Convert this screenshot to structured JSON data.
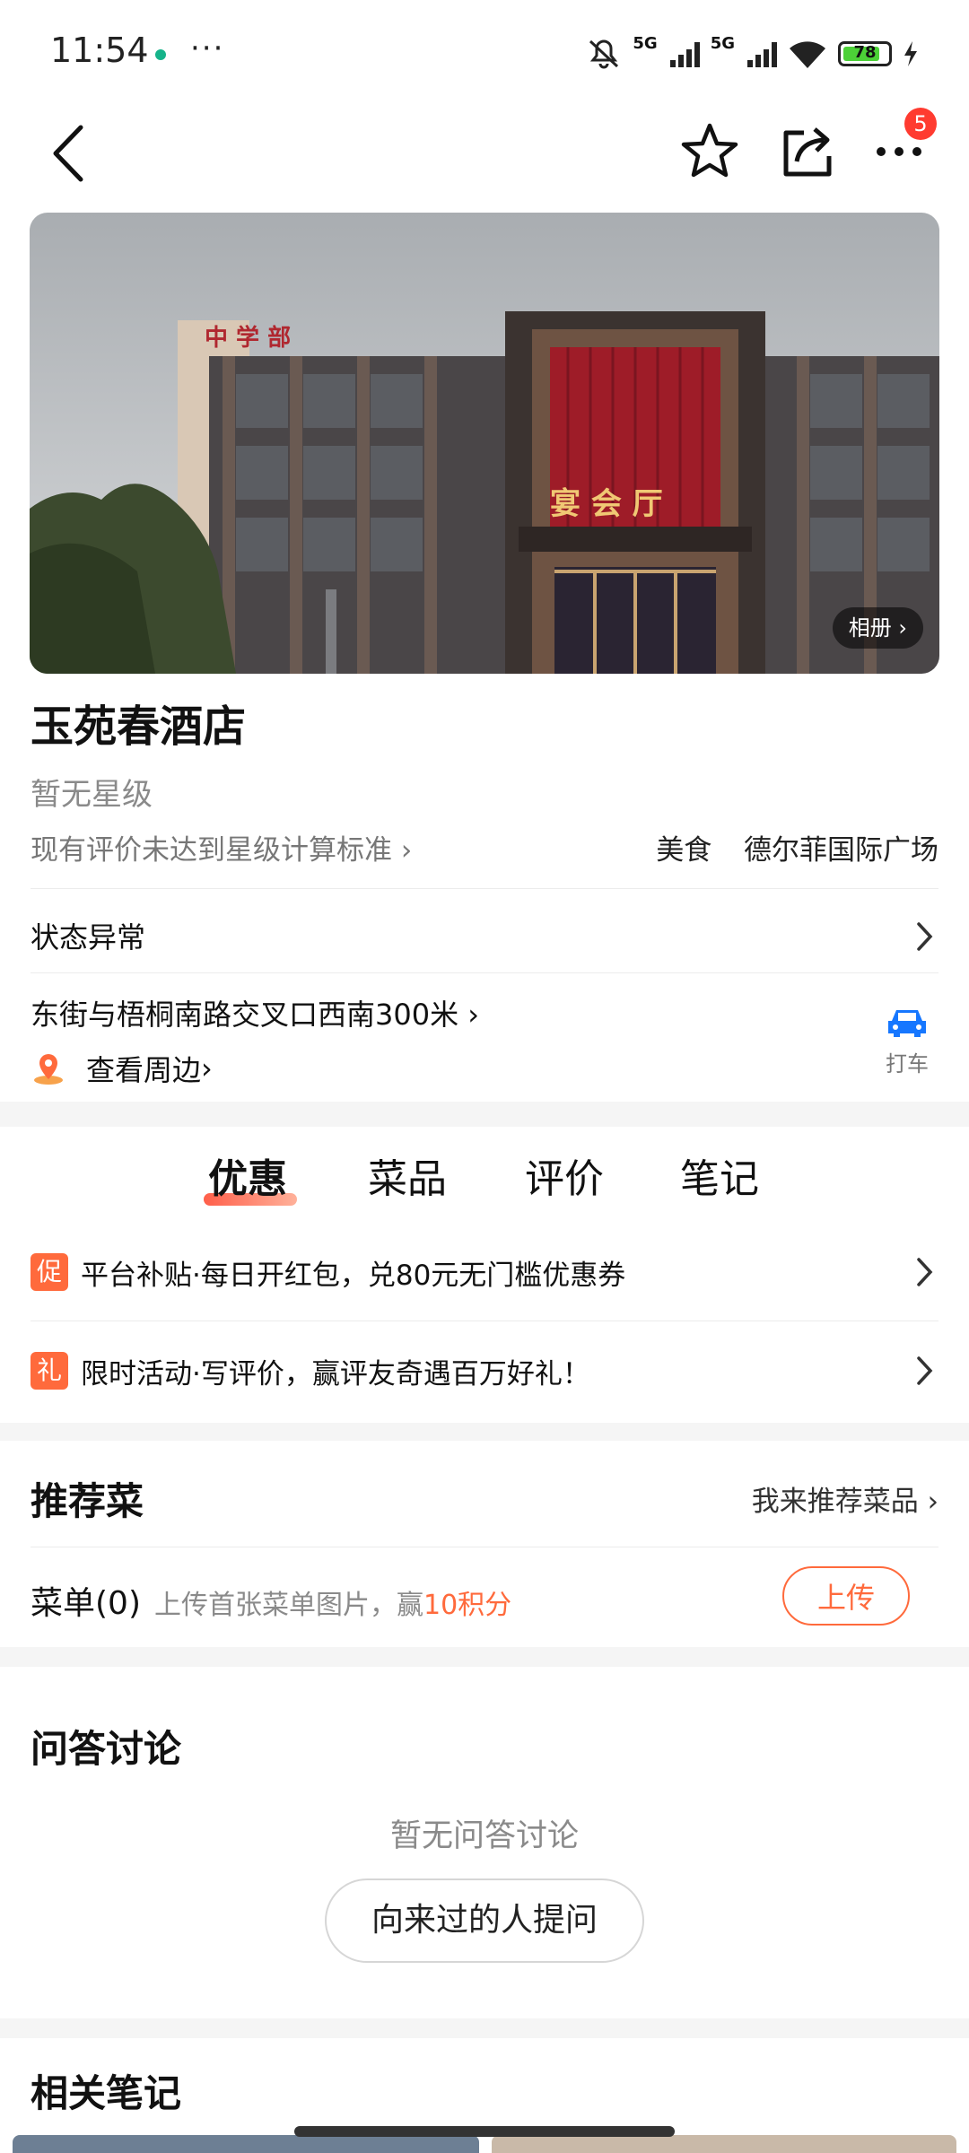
{
  "status_bar": {
    "time": "11:54",
    "dots": "···",
    "net1": "5G",
    "net2": "5G",
    "battery": "78"
  },
  "nav": {
    "badge_count": "5"
  },
  "hero": {
    "album_label": "相册"
  },
  "shop": {
    "name": "玉苑春酒店",
    "star_level": "暂无星级",
    "rating_note": "现有评价未达到星级计算标准",
    "category": "美食",
    "area": "德尔菲国际广场",
    "status": "状态异常",
    "address": "东街与梧桐南路交叉口西南300米",
    "nearby": "查看周边",
    "taxi": "打车"
  },
  "tabs": [
    {
      "label": "优惠"
    },
    {
      "label": "菜品"
    },
    {
      "label": "评价"
    },
    {
      "label": "笔记"
    }
  ],
  "promos": [
    {
      "tag": "促",
      "text": "平台补贴·每日开红包，兑80元无门槛优惠券"
    },
    {
      "tag": "礼",
      "text": "限时活动·写评价，赢评友奇遇百万好礼！"
    }
  ],
  "recommend": {
    "title": "推荐菜",
    "link": "我来推荐菜品",
    "menu_label": "菜单(0)",
    "menu_hint": "上传首张菜单图片，赢",
    "menu_reward": "10积分",
    "upload_btn": "上传"
  },
  "qa": {
    "title": "问答讨论",
    "empty": "暂无问答讨论",
    "ask_btn": "向来过的人提问"
  },
  "notes": {
    "title": "相关笔记"
  },
  "colors": {
    "accent": "#ff6a3c",
    "badge": "#ff3b30",
    "taxi": "#1677ff"
  }
}
